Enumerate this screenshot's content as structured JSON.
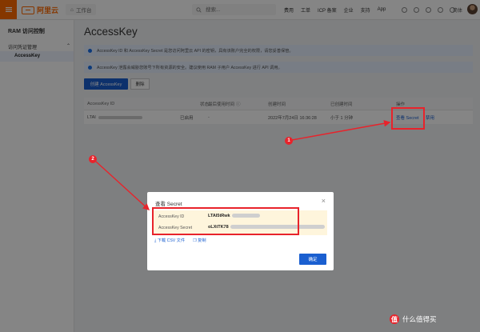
{
  "topbar": {
    "logo_text": "阿里云",
    "workbench": "工作台",
    "search_placeholder": "搜索...",
    "nav_links": [
      "费用",
      "工单",
      "ICP 备案",
      "企业",
      "支持",
      "App"
    ],
    "lang": "简体"
  },
  "sidebar": {
    "title": "RAM 访问控制",
    "group": "访问凭证管理",
    "item": "AccessKey"
  },
  "page": {
    "title": "AccessKey",
    "notice1": "AccessKey ID 和 AccessKey Secret 是您访问阿里云 API 的密钥，具有该账户完全的权限，请您妥善保管。",
    "notice2": "AccessKey 泄露会威胁您账号下所有资源的安全。建议使用 RAM 子用户 AccessKey 进行 API 调用。",
    "create_button": "创建 AccessKey",
    "delete_button": "删除"
  },
  "table": {
    "headers": [
      "AccessKey ID",
      "状态",
      "最后使用时间",
      "创建时间",
      "已创建时间",
      "操作"
    ],
    "row": {
      "id": "LTAI",
      "status": "已启用",
      "last_used": "-",
      "created": "2022年7月24日 16:36:28",
      "age": "小于 1 分钟",
      "action_view": "查看 Secret",
      "action_disable": "禁用"
    }
  },
  "dialog": {
    "title": "查看 Secret",
    "close": "×",
    "id_label": "AccessKey ID",
    "id_value": "LTAI5tRwk",
    "secret_label": "AccessKey Secret",
    "secret_value": "oLXtTK78",
    "download": "下载 CSV 文件",
    "copy": "复制",
    "ok": "确定"
  },
  "annotations": {
    "step1": "1",
    "step2": "2",
    "highlight_color": "#e8232b"
  },
  "watermark": {
    "icon": "值",
    "text": "什么值得买"
  },
  "colors": {
    "brand": "#ff6a00",
    "primary": "#1a5fd0"
  }
}
